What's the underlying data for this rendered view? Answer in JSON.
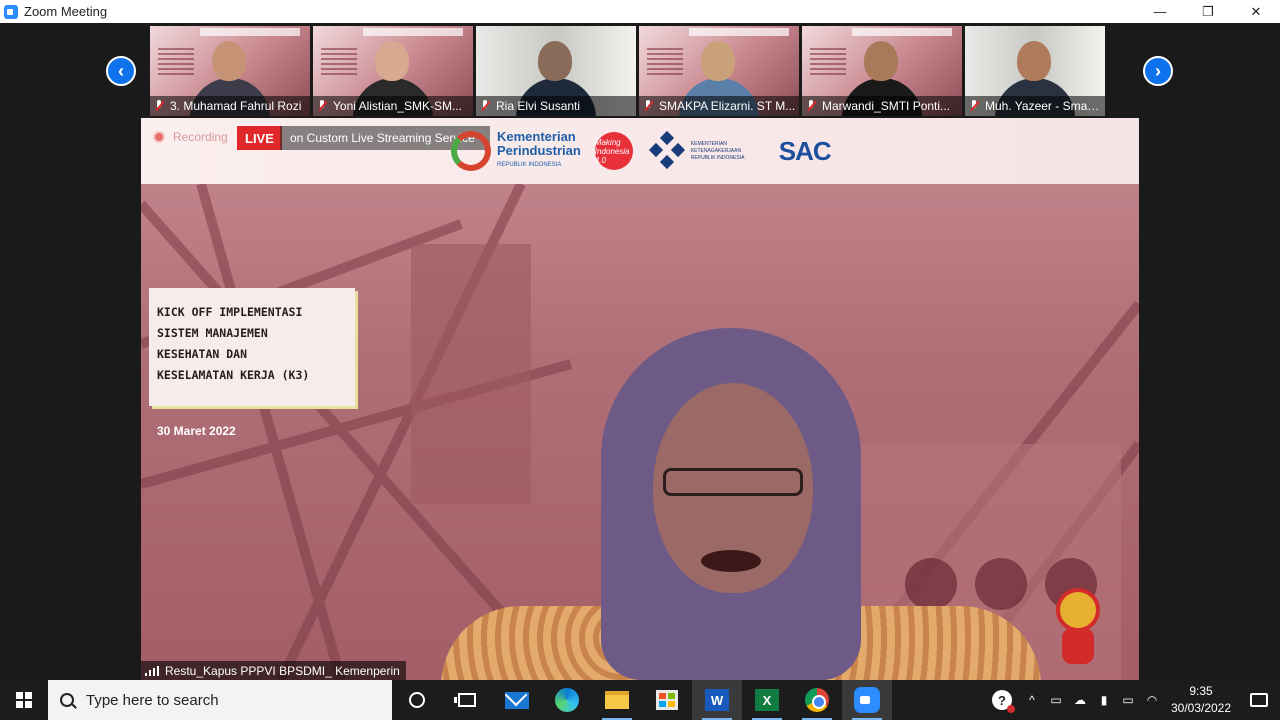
{
  "window": {
    "title": "Zoom Meeting",
    "minimize": "—",
    "maximize": "❐",
    "close": "✕"
  },
  "gallery": {
    "prev": "‹",
    "next": "›",
    "participants": [
      {
        "name": "3. Muhamad Fahrul Rozi",
        "muted": true
      },
      {
        "name": "Yoni Alistian_SMK-SM...",
        "muted": true
      },
      {
        "name": "Ria Elvi Susanti",
        "muted": true
      },
      {
        "name": "SMAKPA Elizarni. ST M...",
        "muted": true
      },
      {
        "name": "Marwandi_SMTI Ponti...",
        "muted": true
      },
      {
        "name": "Muh. Yazeer - Smak M...",
        "muted": true
      }
    ]
  },
  "main": {
    "recording": "Recording",
    "live": "LIVE",
    "stream_service": "on Custom Live Streaming Service",
    "stream_caret": "▾",
    "logos": {
      "kemenperin_line1": "Kementerian",
      "kemenperin_line2": "Perindustrian",
      "kemenperin_sub": "REPUBLIK INDONESIA",
      "making": "Making Indonesia 4.0",
      "naker": "KEMENTERIAN KETENAGAKERJAAN REPUBLIK INDONESIA",
      "sac": "SAC"
    },
    "slide_title": [
      "KICK OFF IMPLEMENTASI",
      "SISTEM MANAJEMEN",
      "KESEHATAN DAN",
      "KESELAMATAN KERJA (K3)"
    ],
    "slide_date": "30 Maret 2022",
    "speaker": "Restu_Kapus PPPVI BPSDMI_ Kemenperin"
  },
  "taskbar": {
    "search_placeholder": "Type here to search",
    "apps": [
      "cortana-icon",
      "task-view-icon",
      "mail-icon",
      "edge-icon",
      "file-explorer-icon",
      "store-icon",
      "word-icon",
      "excel-icon",
      "chrome-icon",
      "zoom-icon"
    ],
    "word_letter": "W",
    "excel_letter": "X",
    "tray_chevron": "^",
    "time": "9:35",
    "date": "30/03/2022"
  }
}
